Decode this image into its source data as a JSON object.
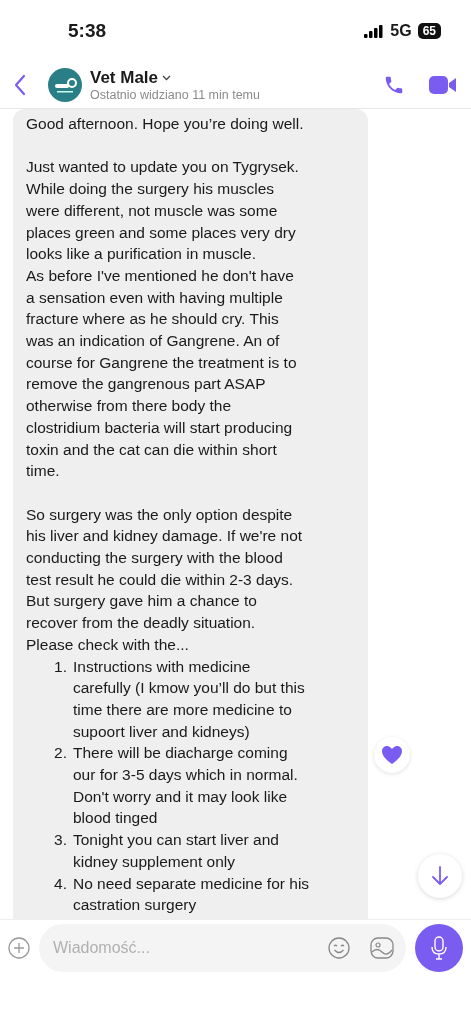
{
  "status_bar": {
    "time": "5:38",
    "network": "5G",
    "battery": "65"
  },
  "header": {
    "name": "Vet Male",
    "last_seen": "Ostatnio widziano 11 min temu"
  },
  "message": {
    "paragraphs": [
      "Good afternoon. Hope you’re doing well.",
      "Just wanted to update you on Tygrysek.\nWhile doing the surgery his muscles\nwere different, not muscle was some\nplaces green and some places very dry\nlooks like a purification in muscle.\nAs before I've mentioned he don't have\na sensation even with having multiple\nfracture where as he should cry. This\nwas an indication of Gangrene. An of\ncourse for Gangrene the treatment is to\nremove the gangrenous part ASAP\notherwise from there body the\nclostridium bacteria will start producing\ntoxin and the cat can die within short\ntime.",
      "So surgery was the only option despite\nhis liver and kidney damage. If we're not\nconducting the surgery with the blood\ntest result he could die within 2-3 days.\nBut surgery gave him a chance to\nrecover from the deadly situation.\nPlease check with the..."
    ],
    "list": [
      {
        "number": "1.",
        "text": "Instructions with medicine\ncarefully (I kmow you’ll do but this\ntime there are more medicine to\nsupoort liver and kidneys)"
      },
      {
        "number": "2.",
        "text": "There will be diacharge coming\nour for 3-5 days which in normal.\nDon't worry and it may look like\nblood tinged"
      },
      {
        "number": "3.",
        "text": "Tonight you can start liver and\nkidney supplement only"
      },
      {
        "number": "4.",
        "text": "No need separate medicine for his\ncastration surgery"
      }
    ]
  },
  "composer": {
    "placeholder": "Wiadomość..."
  }
}
